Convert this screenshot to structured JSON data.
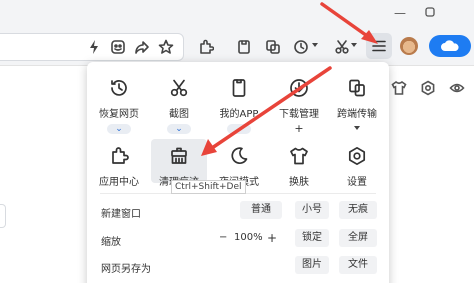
{
  "window": {
    "minimize_icon": "minimize-icon",
    "maximize_icon": "maximize-icon"
  },
  "toolbar": {
    "address_value": "",
    "icons": [
      "lightning-icon",
      "translate-icon",
      "share-icon",
      "star-icon",
      "extensions-icon",
      "reading-icon",
      "copy-icon",
      "history-icon",
      "scissors-icon",
      "menu-icon",
      "avatar",
      "cloud-icon"
    ]
  },
  "menu": {
    "tools_row1": [
      {
        "label": "恢复网页",
        "icon": "history-icon",
        "chip": "⌄"
      },
      {
        "label": "截图",
        "icon": "scissors-icon",
        "chip": "⌄"
      },
      {
        "label": "我的APP",
        "icon": "phone-icon",
        "chip": "⌄"
      },
      {
        "label": "下载管理",
        "icon": "download-icon",
        "chip": "+"
      },
      {
        "label": "跨端传输",
        "icon": "transfer-icon",
        "chip": ""
      }
    ],
    "tools_row2": [
      {
        "label": "应用中心",
        "icon": "puzzle-icon"
      },
      {
        "label": "清理痕迹",
        "icon": "broom-icon"
      },
      {
        "label": "夜间模式",
        "icon": "moon-icon"
      },
      {
        "label": "换肤",
        "icon": "shirt-icon"
      },
      {
        "label": "设置",
        "icon": "gear-icon"
      }
    ],
    "tooltip": "Ctrl+Shift+Del",
    "new_window": {
      "label": "新建窗口",
      "options": [
        "普通",
        "小号",
        "无痕"
      ]
    },
    "zoom": {
      "label": "缩放",
      "minus": "−",
      "value": "100%",
      "plus": "+",
      "lock": "锁定",
      "fullscreen": "全屏"
    },
    "save_page": {
      "label": "网页另存为",
      "options": [
        "图片",
        "文件"
      ]
    }
  },
  "colors": {
    "arrow": "#e8443a",
    "accent": "#1e7cf2",
    "chip_text": "#2a6ed6"
  }
}
